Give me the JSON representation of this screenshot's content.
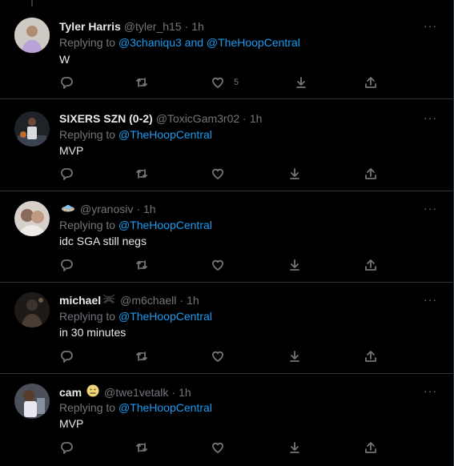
{
  "tweets": [
    {
      "name": "Tyler Harris",
      "handle": "@tyler_h15",
      "time": "1h",
      "replying_prefix": "Replying to",
      "replying_to": "@3chaniqu3",
      "replying_joiner": "and",
      "replying_to_2": "@TheHoopCentral",
      "text": "W",
      "like_count": "5",
      "avatar_color": "#9a8d86"
    },
    {
      "name": "SIXERS SZN (0-2)",
      "handle": "@ToxicGam3r02",
      "time": "1h",
      "replying_prefix": "Replying to",
      "replying_to": "@TheHoopCentral",
      "text": "MVP",
      "avatar_color": "#2c3138"
    },
    {
      "name": "",
      "handle": "@yranosiv",
      "time": "1h",
      "replying_prefix": "Replying to",
      "replying_to": "@TheHoopCentral",
      "text": "idc SGA still negs",
      "avatar_color": "#c9b8ad"
    },
    {
      "name": "michael",
      "handle": "@m6chaell",
      "time": "1h",
      "replying_prefix": "Replying to",
      "replying_to": "@TheHoopCentral",
      "text": "in 30 minutes",
      "avatar_color": "#2a2622"
    },
    {
      "name": "cam",
      "handle": "@twe1vetalk",
      "time": "1h",
      "replying_prefix": "Replying to",
      "replying_to": "@TheHoopCentral",
      "text": "MVP",
      "avatar_color": "#6b6f78"
    }
  ],
  "dot": "·",
  "more_label": "···",
  "colors": {
    "link": "#1d9bf0",
    "muted": "#71767b",
    "text": "#e7e9ea",
    "divider": "#2f3336",
    "background": "#000000"
  },
  "icons": [
    "reply-icon",
    "retweet-icon",
    "like-icon",
    "download-icon",
    "share-icon",
    "more-icon",
    "spider-emoji-icon",
    "neutral-face-emoji-icon",
    "ufo-emoji-icon"
  ]
}
